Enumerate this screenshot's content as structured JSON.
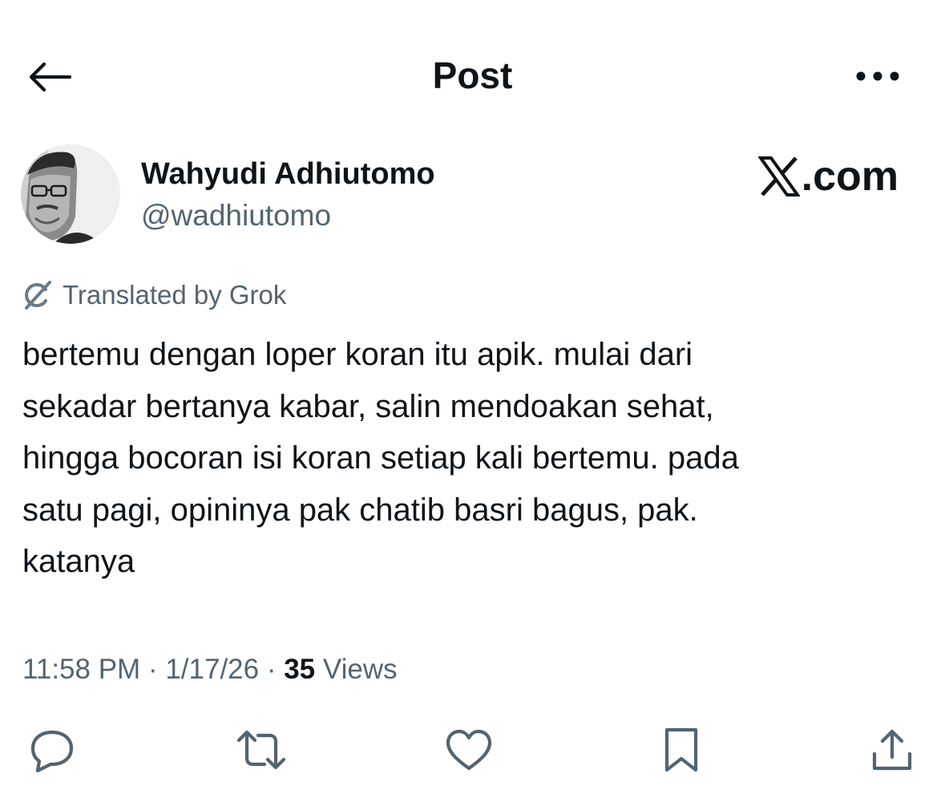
{
  "header": {
    "title": "Post",
    "back_icon": "arrow-left-icon",
    "more_icon": "more-horizontal-icon"
  },
  "author": {
    "name": "Wahyudi Adhiutomo",
    "handle": "@wadhiutomo",
    "avatar": "user-avatar-photo"
  },
  "brand": {
    "logo_icon": "x-logo-icon",
    "suffix": ".com"
  },
  "translation": {
    "icon": "grok-icon",
    "label": "Translated by Grok"
  },
  "post": {
    "text": "bertemu dengan loper koran itu apik. mulai dari\nsekadar bertanya kabar, salin mendoakan sehat,\nhingga bocoran isi koran setiap kali bertemu. pada\nsatu pagi, opininya pak chatib basri bagus, pak.\nkatanya"
  },
  "meta": {
    "time": "11:58 PM",
    "separator": " · ",
    "date": "1/17/26",
    "views_count": "35",
    "views_label": " Views"
  },
  "actions": [
    {
      "name": "reply",
      "icon": "reply-bubble-icon"
    },
    {
      "name": "repost",
      "icon": "repost-icon"
    },
    {
      "name": "like",
      "icon": "heart-icon"
    },
    {
      "name": "bookmark",
      "icon": "bookmark-icon"
    },
    {
      "name": "share",
      "icon": "share-upload-icon"
    }
  ],
  "colors": {
    "text_primary": "#0f1419",
    "text_secondary": "#536471",
    "background": "#ffffff"
  }
}
